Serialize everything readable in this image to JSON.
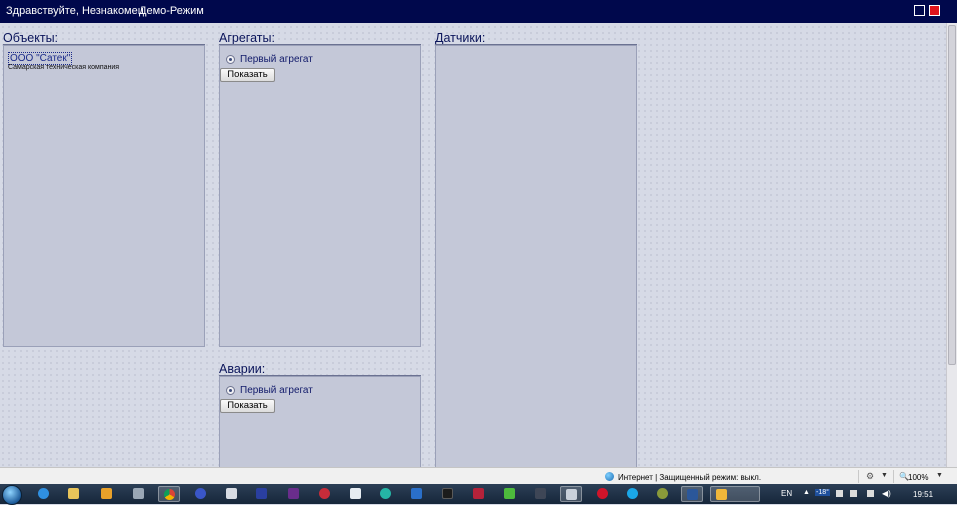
{
  "header": {
    "greeting": "Здравствуйте, Незнакомец",
    "mode": "Демо-Режим"
  },
  "objects": {
    "title": "Объекты:",
    "link": "ООО \"Сатек\"",
    "subtitle": "Самарская техническая компания"
  },
  "aggregates": {
    "title": "Агрегаты:",
    "radio_label": "Первый агрегат",
    "button": "Показать"
  },
  "alarms": {
    "title": "Аварии:",
    "radio_label": "Первый агрегат",
    "button": "Показать"
  },
  "sensors": {
    "title": "Датчики:"
  },
  "statusbar": {
    "zone": "Интернет | Защищенный режим: выкл.",
    "zoom": "100%"
  },
  "taskbar": {
    "language": "EN",
    "temperature": "-18°",
    "time": "19:51"
  },
  "colors": {
    "topbar": "#00084c",
    "close_button": "#e0141b",
    "panel": "#c4c8d8",
    "link": "#1a2a8a"
  },
  "icons": [
    "start-orb",
    "ie-icon",
    "explorer-icon",
    "media-icon",
    "paint-icon",
    "chrome-icon",
    "globe-icon",
    "zoom-icon"
  ]
}
